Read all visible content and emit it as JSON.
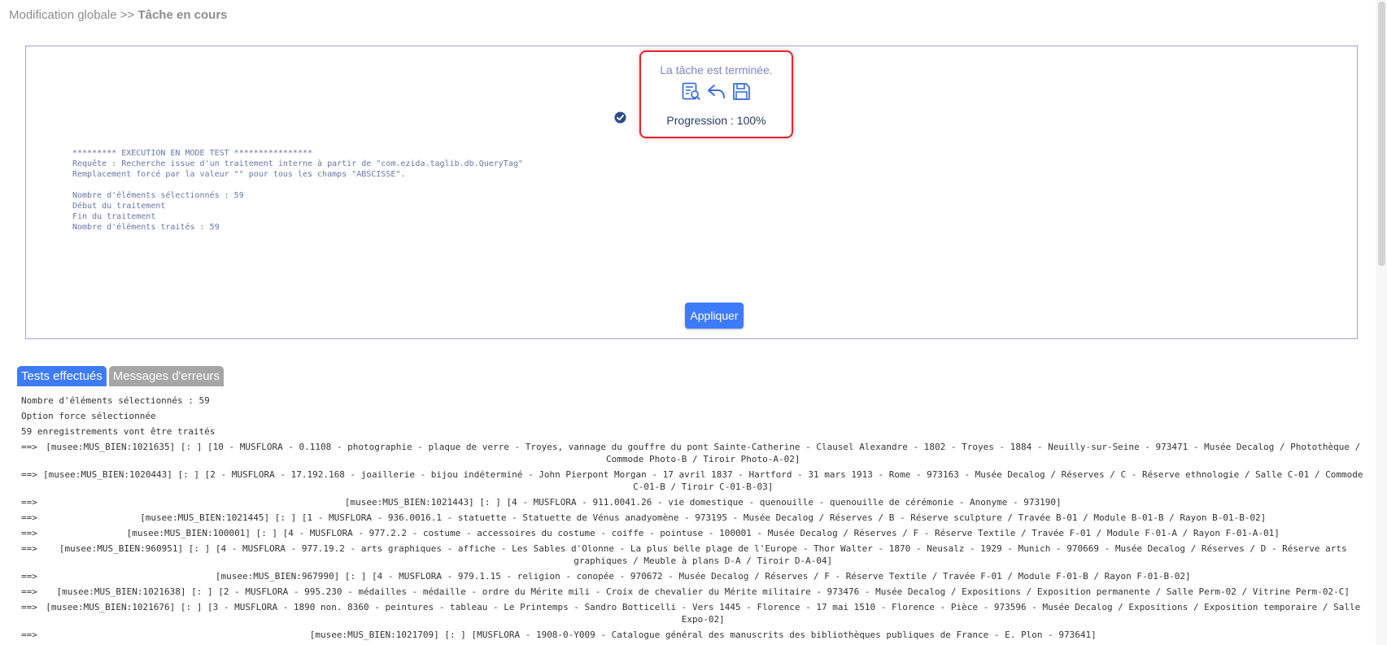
{
  "breadcrumb": {
    "parent": "Modification globale",
    "separator": " >> ",
    "current": "Tâche en cours"
  },
  "status": {
    "message": "La tâche est terminée.",
    "progress_label": "Progression : ",
    "progress_value": "100%",
    "progress_fraction": 1.0,
    "icons": [
      "report-search-icon",
      "undo-icon",
      "save-icon"
    ]
  },
  "log": {
    "lines": [
      "********* EXECUTION EN MODE TEST ****************",
      "Requête : Recherche issue d'un traitement interne à partir de \"com.ezida.taglib.db.QueryTag\"",
      "Remplacement forcé par la valeur \"\" pour tous les champs \"ABSCISSE\".",
      "",
      "Nombre d'éléments sélectionnés : 59",
      "Début du traitement",
      "Fin du traitement",
      "Nombre d'éléments traités : 59"
    ]
  },
  "apply_button": "Appliquer",
  "tabs": [
    {
      "label": "Tests effectués",
      "active": true
    },
    {
      "label": "Messages d'erreurs",
      "active": false
    }
  ],
  "results": {
    "summary": [
      "Nombre d'éléments sélectionnés : 59",
      "Option force sélectionnée",
      "59 enregistrements vont être traités"
    ],
    "arrow": "==> ",
    "records": [
      "[musee:MUS_BIEN:1021635] [: ] [10 - MUSFLORA - 0.1108 - photographie - plaque de verre - Troyes, vannage du gouffre du pont Sainte-Catherine - Clausel Alexandre - 1802 - Troyes - 1884 - Neuilly-sur-Seine - 973471 - Musée Decalog / Photothèque / Commode Photo-B / Tiroir Photo-A-02]",
      "[musee:MUS_BIEN:1020443] [: ] [2 - MUSFLORA - 17.192.168 - joaillerie - bijou indéterminé - John Pierpont Morgan - 17 avril 1837 - Hartford - 31 mars 1913 - Rome - 973163 - Musée Decalog / Réserves / C - Réserve ethnologie / Salle C-01 / Commode C-01-B / Tiroir C-01-B-03]",
      "[musee:MUS_BIEN:1021443] [: ] [4 - MUSFLORA - 911.0041.26 - vie domestique - quenouille - quenouille de cérémonie - Anonyme - 973190]",
      "[musee:MUS_BIEN:1021445] [: ] [1 - MUSFLORA - 936.0016.1 - statuette - Statuette de Vénus anadyomène - 973195 - Musée Decalog / Réserves / B - Réserve sculpture / Travée B-01 / Module B-01-B / Rayon B-01-B-02]",
      "[musee:MUS_BIEN:100001] [: ] [4 - MUSFLORA - 977.2.2 - costume - accessoires du costume - coiffe - pointuse - 100001 - Musée Decalog / Réserves / F - Réserve Textile / Travée F-01 / Module F-01-A / Rayon F-01-A-01]",
      "[musee:MUS_BIEN:960951] [: ] [4 - MUSFLORA - 977.19.2 - arts graphiques - affiche - Les Sables d'Olonne - La plus belle plage de l'Europe - Thor Walter - 1870 - Neusalz - 1929 - Munich - 970669 - Musée Decalog / Réserves / D - Réserve arts graphiques / Meuble à plans D-A / Tiroir D-A-04]",
      "[musee:MUS_BIEN:967990] [: ] [4 - MUSFLORA - 979.1.15 - religion - conopée - 970672 - Musée Decalog / Réserves / F - Réserve Textile / Travée F-01 / Module F-01-B / Rayon F-01-B-02]",
      "[musee:MUS_BIEN:1021638] [: ] [2 - MUSFLORA - 995.230 - médailles - médaille - ordre du Mérite mili - Croix de chevalier du Mérite militaire - 973476 - Musée Decalog / Expositions / Exposition permanente / Salle Perm-02 / Vitrine Perm-02-C]",
      "[musee:MUS_BIEN:1021676] [: ] [3 - MUSFLORA - 1890 non. 8360 - peintures - tableau - Le Printemps - Sandro Botticelli - Vers 1445 - Florence - 17 mai 1510 - Florence - Pièce - 973596 - Musée Decalog / Expositions / Exposition temporaire / Salle Expo-02]",
      "[musee:MUS_BIEN:1021709] [: ] [MUSFLORA - 1908-0-Y009 - Catalogue général des manuscrits des bibliothèques publiques de France - E. Plon - 973641]"
    ]
  }
}
